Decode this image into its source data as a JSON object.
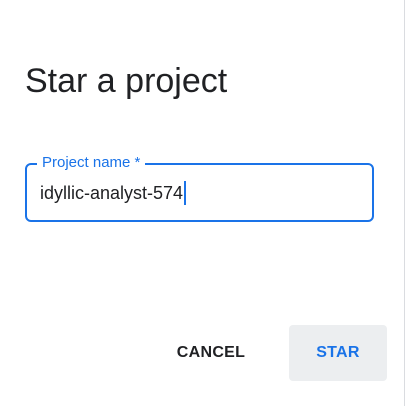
{
  "dialog": {
    "title": "Star a project",
    "field": {
      "label": "Project name *",
      "value": "idyllic-analyst-574"
    },
    "actions": {
      "cancel_label": "CANCEL",
      "star_label": "STAR"
    }
  },
  "colors": {
    "accent": "#1a73e8",
    "text": "#202124",
    "star_button_bg": "#eceef0"
  }
}
